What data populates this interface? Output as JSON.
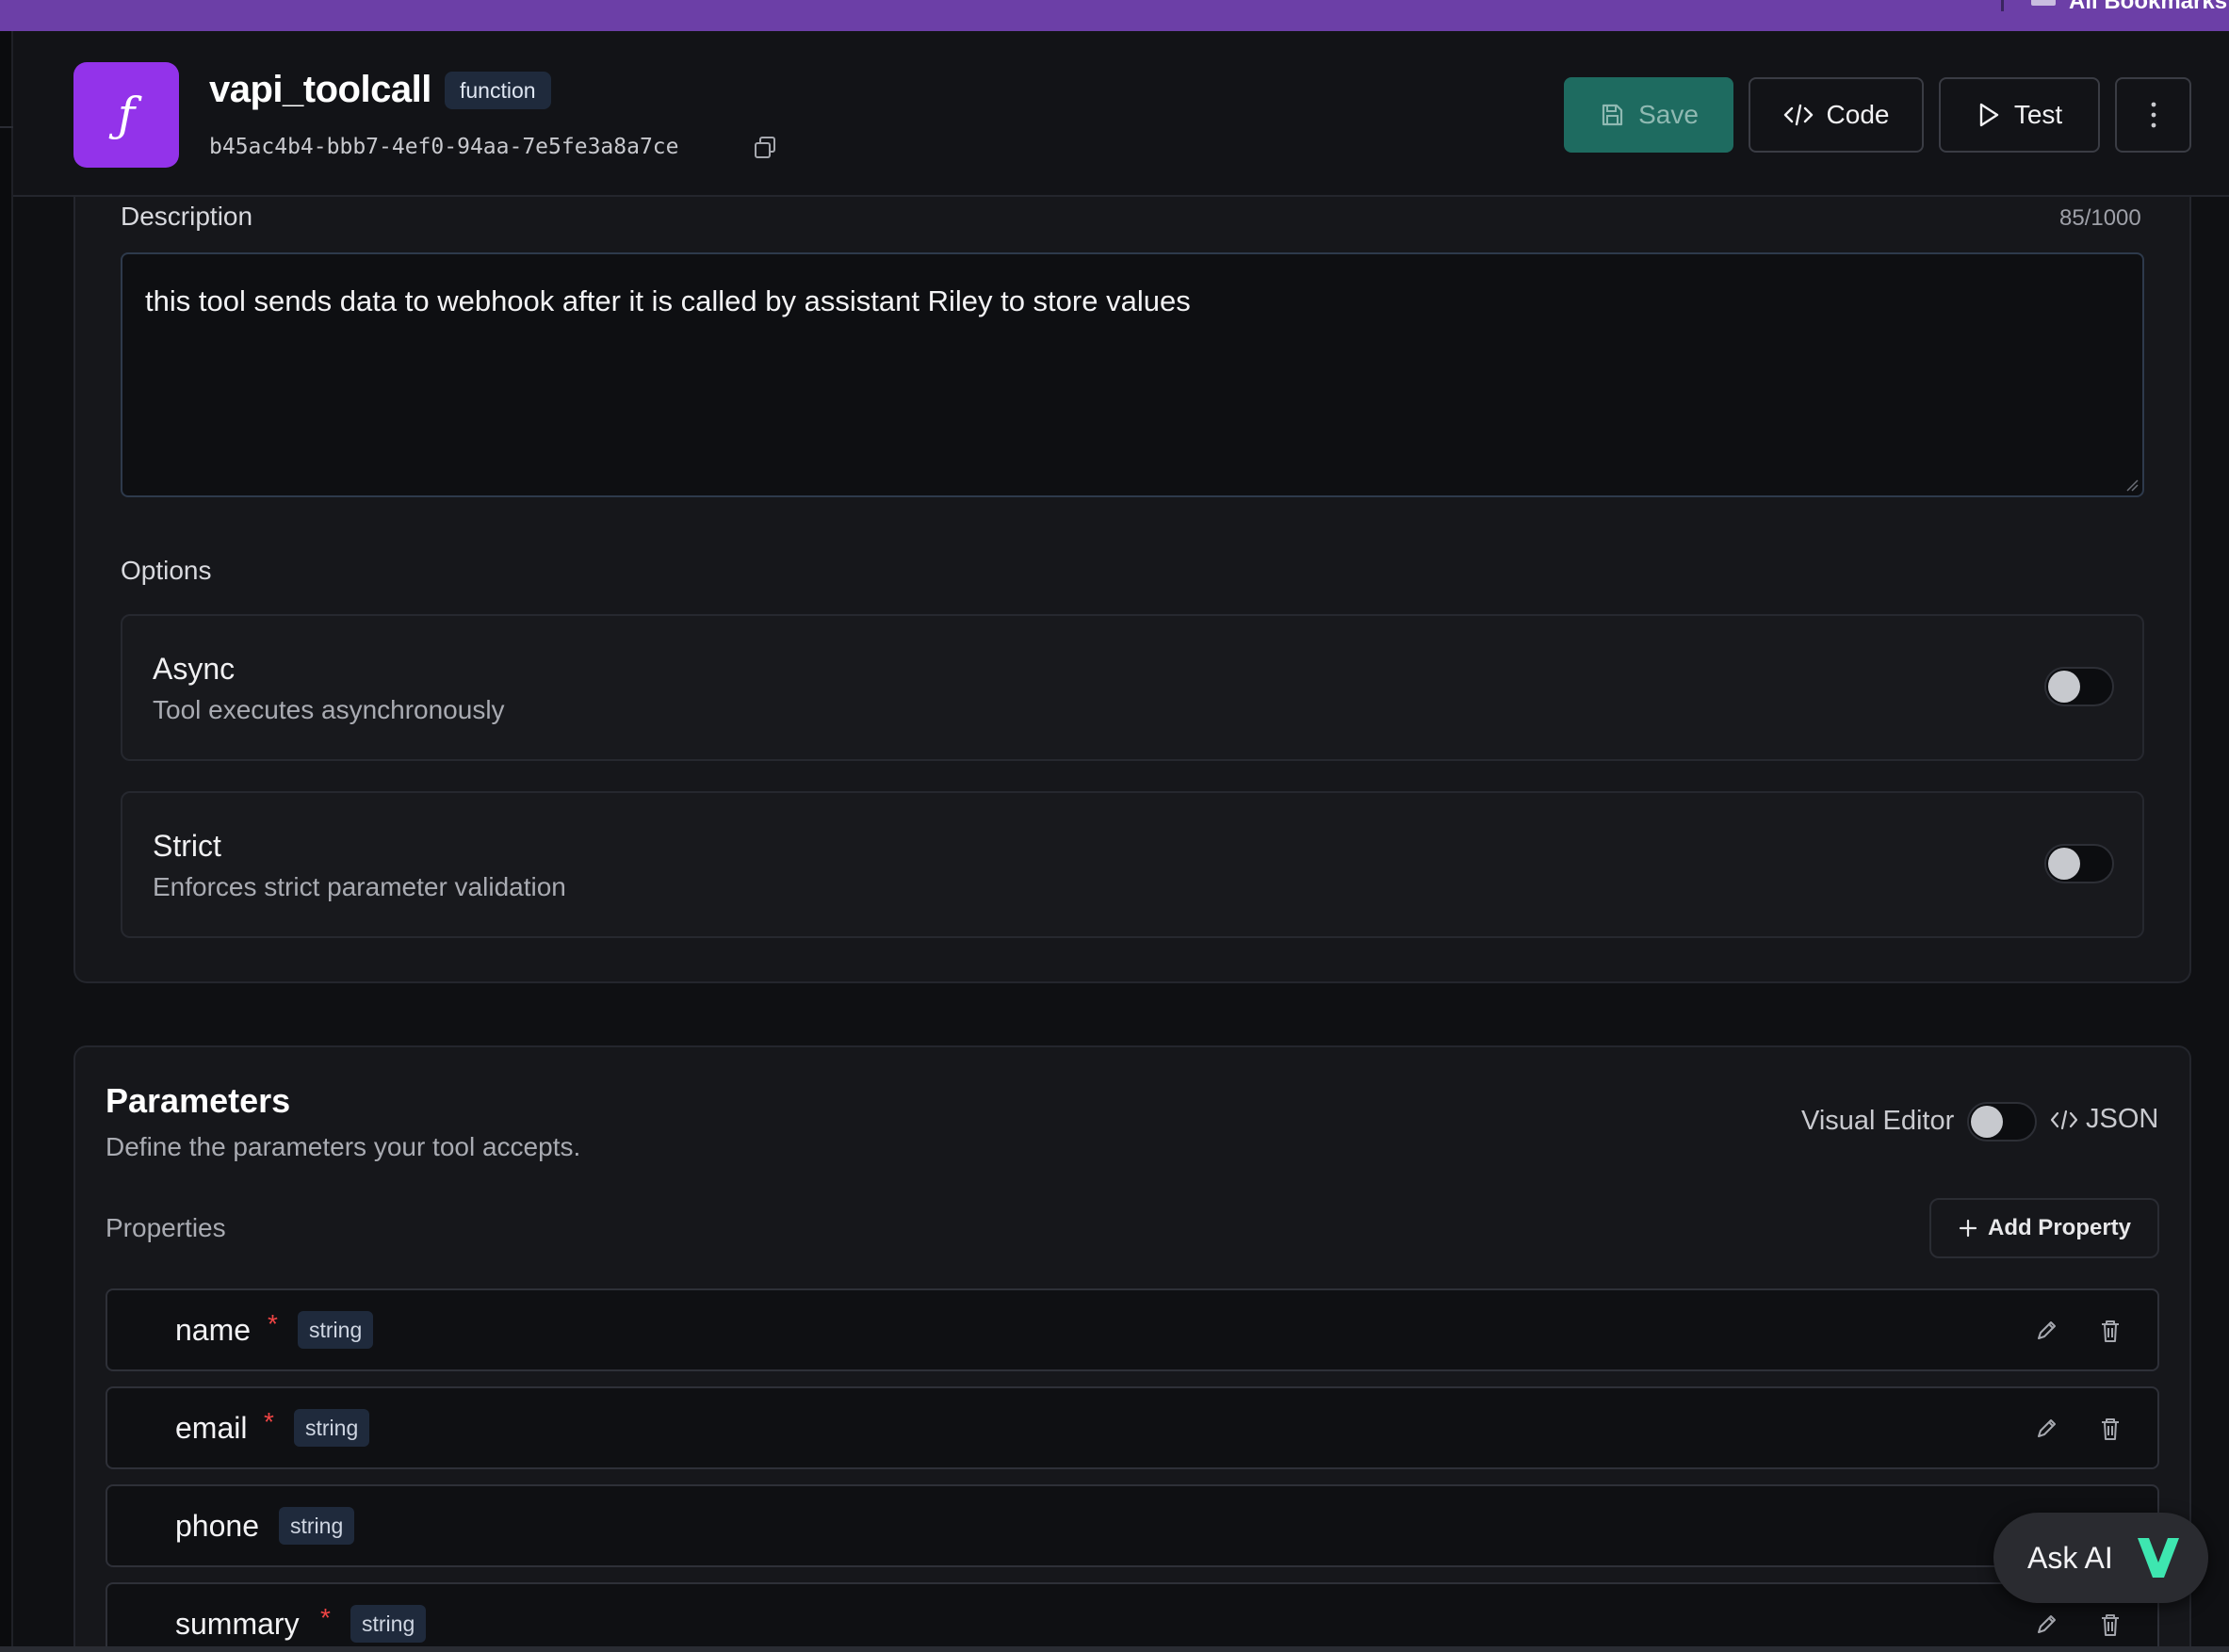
{
  "browser": {
    "bookmarks_label": "All Bookmarks"
  },
  "header": {
    "title": "vapi_toolcall",
    "type_badge": "function",
    "tool_id": "b45ac4b4-bbb7-4ef0-94aa-7e5fe3a8a7ce",
    "save_label": "Save",
    "code_label": "Code",
    "test_label": "Test",
    "icons": [
      "function-icon",
      "copy-icon",
      "save-icon",
      "code-icon",
      "play-icon",
      "more-vertical-icon"
    ]
  },
  "description": {
    "label": "Description",
    "counter": "85/1000",
    "value": "this tool sends data to webhook after it is called by assistant Riley to store values"
  },
  "options": {
    "label": "Options",
    "items": [
      {
        "title": "Async",
        "subtitle": "Tool executes asynchronously",
        "enabled": false
      },
      {
        "title": "Strict",
        "subtitle": "Enforces strict parameter validation",
        "enabled": false
      }
    ]
  },
  "parameters": {
    "title": "Parameters",
    "subtitle": "Define the parameters your tool accepts.",
    "visual_editor_label": "Visual Editor",
    "visual_editor_enabled": false,
    "json_label": "JSON",
    "properties_label": "Properties",
    "add_property_label": "Add Property",
    "properties": [
      {
        "name": "name",
        "required": true,
        "type": "string"
      },
      {
        "name": "email",
        "required": true,
        "type": "string"
      },
      {
        "name": "phone",
        "required": false,
        "type": "string"
      },
      {
        "name": "summary",
        "required": true,
        "type": "string"
      }
    ]
  },
  "ask_ai": {
    "label": "Ask AI",
    "accent_color": "#3ee6b0"
  },
  "colors": {
    "brand_purple": "#9333ea",
    "save_button": "#1e6b60",
    "required_star": "#ef4444"
  }
}
